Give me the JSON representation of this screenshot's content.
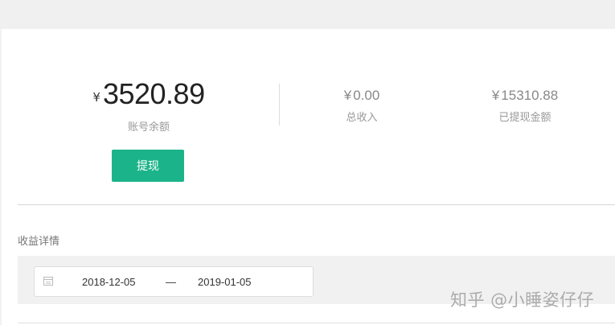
{
  "balance": {
    "currency_symbol": "¥",
    "amount": "3520.89",
    "label": "账号余额",
    "withdraw_button": "提现"
  },
  "stats": {
    "total_income": {
      "currency_symbol": "¥",
      "value": "0.00",
      "label": "总收入"
    },
    "withdrawn": {
      "currency_symbol": "¥",
      "value": "15310.88",
      "label": "已提现金额"
    }
  },
  "earnings": {
    "section_title": "收益详情",
    "date_range": {
      "start": "2018-12-05",
      "separator": "—",
      "end": "2019-01-05"
    }
  },
  "watermark": {
    "text": "知乎 @小睡姿仔仔"
  },
  "colors": {
    "accent": "#1bb48a",
    "muted_text": "#999999",
    "panel_bg": "#ffffff",
    "page_bg": "#f2f2f2"
  },
  "icons": {
    "date_picker": "calendar-icon"
  }
}
